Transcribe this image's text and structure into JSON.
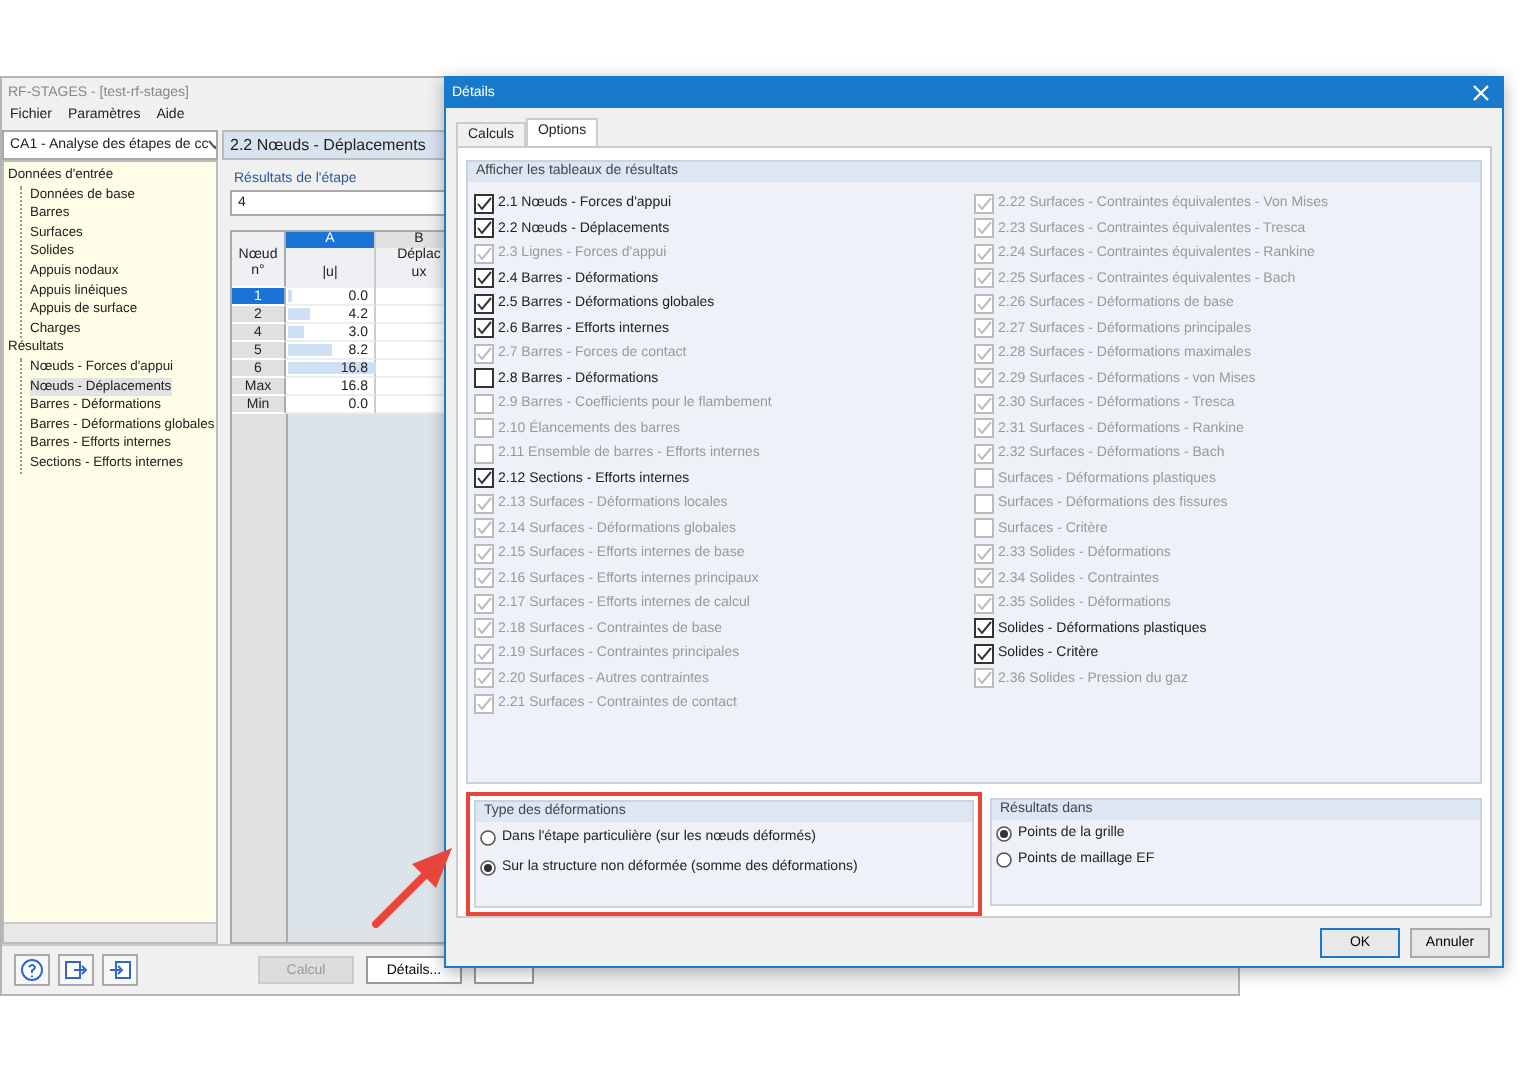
{
  "main_window": {
    "title": "RF-STAGES - [test-rf-stages]",
    "menu": [
      "Fichier",
      "Paramètres",
      "Aide"
    ],
    "case_selector": "CA1 - Analyse des étapes de cc",
    "navigator": [
      {
        "label": "Données d'entrée",
        "selected": false,
        "children": [
          {
            "label": "Données de base",
            "selected": false
          },
          {
            "label": "Barres",
            "selected": false
          },
          {
            "label": "Surfaces",
            "selected": false
          },
          {
            "label": "Solides",
            "selected": false
          },
          {
            "label": "Appuis nodaux",
            "selected": false
          },
          {
            "label": "Appuis linéiques",
            "selected": false
          },
          {
            "label": "Appuis de surface",
            "selected": false
          },
          {
            "label": "Charges",
            "selected": false
          }
        ]
      },
      {
        "label": "Résultats",
        "selected": false,
        "children": [
          {
            "label": "Nœuds - Forces d'appui",
            "selected": false
          },
          {
            "label": "Nœuds - Déplacements",
            "selected": true
          },
          {
            "label": "Barres - Déformations",
            "selected": false
          },
          {
            "label": "Barres - Déformations globales",
            "selected": false
          },
          {
            "label": "Barres - Efforts internes",
            "selected": false
          },
          {
            "label": "Sections - Efforts internes",
            "selected": false
          }
        ]
      }
    ],
    "panel_title": "2.2 Nœuds - Déplacements",
    "stage_label": "Résultats de l'étape",
    "stage_value": "4",
    "row_header": "Nœud n°",
    "columns": [
      {
        "letter": "A",
        "unit": "|u|",
        "selected": true
      },
      {
        "letter": "B",
        "title": "Déplac",
        "unit": "ux",
        "selected": false
      }
    ],
    "rows": [
      {
        "kind": "node",
        "node": "1",
        "value": "0.0",
        "level": 0,
        "selected": true
      },
      {
        "kind": "node",
        "node": "2",
        "value": "4.2",
        "level": 0.25,
        "selected": false
      },
      {
        "kind": "node",
        "node": "4",
        "value": "3.0",
        "level": 0.18,
        "selected": false
      },
      {
        "kind": "node",
        "node": "5",
        "value": "8.2",
        "level": 0.49,
        "selected": false
      },
      {
        "kind": "node",
        "node": "6",
        "value": "16.8",
        "level": 1,
        "selected": false
      },
      {
        "kind": "summary",
        "node": "Max",
        "value": "16.8",
        "selected": false
      },
      {
        "kind": "summary",
        "node": "Min",
        "value": "0.0",
        "selected": false
      }
    ],
    "buttons": [
      {
        "label": "Calcul",
        "disabled": true
      },
      {
        "label": "Détails...",
        "disabled": false
      }
    ]
  },
  "dialog": {
    "title": "Détails",
    "tabs": [
      {
        "label": "Calculs",
        "selected": false
      },
      {
        "label": "Options",
        "selected": true
      }
    ],
    "results_group": {
      "title": "Afficher les tableaux de résultats",
      "left_items": [
        {
          "label": "2.1 Nœuds - Forces d'appui",
          "checked": true,
          "disabled": false
        },
        {
          "label": "2.2 Nœuds - Déplacements",
          "checked": true,
          "disabled": false
        },
        {
          "label": "2.3 Lignes - Forces d'appui",
          "checked": true,
          "disabled": true
        },
        {
          "label": "2.4 Barres - Déformations",
          "checked": true,
          "disabled": false
        },
        {
          "label": "2.5 Barres - Déformations globales",
          "checked": true,
          "disabled": false
        },
        {
          "label": "2.6 Barres - Efforts internes",
          "checked": true,
          "disabled": false
        },
        {
          "label": "2.7 Barres - Forces de contact",
          "checked": true,
          "disabled": true
        },
        {
          "label": "2.8 Barres - Déformations",
          "checked": false,
          "disabled": false
        },
        {
          "label": "2.9 Barres - Coefficients pour le flambement",
          "checked": false,
          "disabled": true
        },
        {
          "label": "2.10 Élancements des barres",
          "checked": false,
          "disabled": true
        },
        {
          "label": "2.11 Ensemble de barres - Efforts internes",
          "checked": false,
          "disabled": true
        },
        {
          "label": "2.12 Sections - Efforts internes",
          "checked": true,
          "disabled": false
        },
        {
          "label": "2.13 Surfaces - Déformations locales",
          "checked": true,
          "disabled": true
        },
        {
          "label": "2.14 Surfaces - Déformations globales",
          "checked": true,
          "disabled": true
        },
        {
          "label": "2.15 Surfaces - Efforts internes de base",
          "checked": true,
          "disabled": true
        },
        {
          "label": "2.16 Surfaces - Efforts internes principaux",
          "checked": true,
          "disabled": true
        },
        {
          "label": "2.17 Surfaces - Efforts internes de calcul",
          "checked": true,
          "disabled": true
        },
        {
          "label": "2.18 Surfaces - Contraintes de base",
          "checked": true,
          "disabled": true
        },
        {
          "label": "2.19 Surfaces - Contraintes principales",
          "checked": true,
          "disabled": true
        },
        {
          "label": "2.20 Surfaces - Autres contraintes",
          "checked": true,
          "disabled": true
        },
        {
          "label": "2.21 Surfaces - Contraintes de contact",
          "checked": true,
          "disabled": true
        }
      ],
      "right_items": [
        {
          "label": "2.22 Surfaces - Contraintes équivalentes - Von Mises",
          "checked": true,
          "disabled": true
        },
        {
          "label": "2.23 Surfaces - Contraintes équivalentes - Tresca",
          "checked": true,
          "disabled": true
        },
        {
          "label": "2.24 Surfaces - Contraintes équivalentes - Rankine",
          "checked": true,
          "disabled": true
        },
        {
          "label": "2.25 Surfaces - Contraintes équivalentes - Bach",
          "checked": true,
          "disabled": true
        },
        {
          "label": "2.26 Surfaces - Déformations de base",
          "checked": true,
          "disabled": true
        },
        {
          "label": "2.27 Surfaces - Déformations principales",
          "checked": true,
          "disabled": true
        },
        {
          "label": "2.28 Surfaces - Déformations maximales",
          "checked": true,
          "disabled": true
        },
        {
          "label": "2.29 Surfaces - Déformations - von Mises",
          "checked": true,
          "disabled": true
        },
        {
          "label": "2.30 Surfaces - Déformations - Tresca",
          "checked": true,
          "disabled": true
        },
        {
          "label": "2.31 Surfaces - Déformations - Rankine",
          "checked": true,
          "disabled": true
        },
        {
          "label": "2.32 Surfaces - Déformations - Bach",
          "checked": true,
          "disabled": true
        },
        {
          "label": "Surfaces - Déformations plastiques",
          "checked": false,
          "disabled": true
        },
        {
          "label": "Surfaces - Déformations des fissures",
          "checked": false,
          "disabled": true
        },
        {
          "label": "Surfaces - Critère",
          "checked": false,
          "disabled": true
        },
        {
          "label": "2.33 Solides - Déformations",
          "checked": true,
          "disabled": true
        },
        {
          "label": "2.34 Solides - Contraintes",
          "checked": true,
          "disabled": true
        },
        {
          "label": "2.35 Solides - Déformations",
          "checked": true,
          "disabled": true
        },
        {
          "label": "Solides - Déformations plastiques",
          "checked": true,
          "disabled": false
        },
        {
          "label": "Solides - Critère",
          "checked": true,
          "disabled": false
        },
        {
          "label": "2.36 Solides - Pression du gaz",
          "checked": true,
          "disabled": true
        }
      ]
    },
    "deformation_group": {
      "title": "Type des déformations",
      "options": [
        {
          "label": "Dans l'étape particulière (sur les nœuds déformés)",
          "selected": false
        },
        {
          "label": "Sur la structure non déformée (somme des déformations)",
          "selected": true
        }
      ]
    },
    "results_in_group": {
      "title": "Résultats dans",
      "options": [
        {
          "label": "Points de la grille",
          "selected": true
        },
        {
          "label": "Points de maillage EF",
          "selected": false
        }
      ]
    },
    "buttons": [
      {
        "label": "OK",
        "default": true
      },
      {
        "label": "Annuler",
        "default": false
      }
    ]
  }
}
